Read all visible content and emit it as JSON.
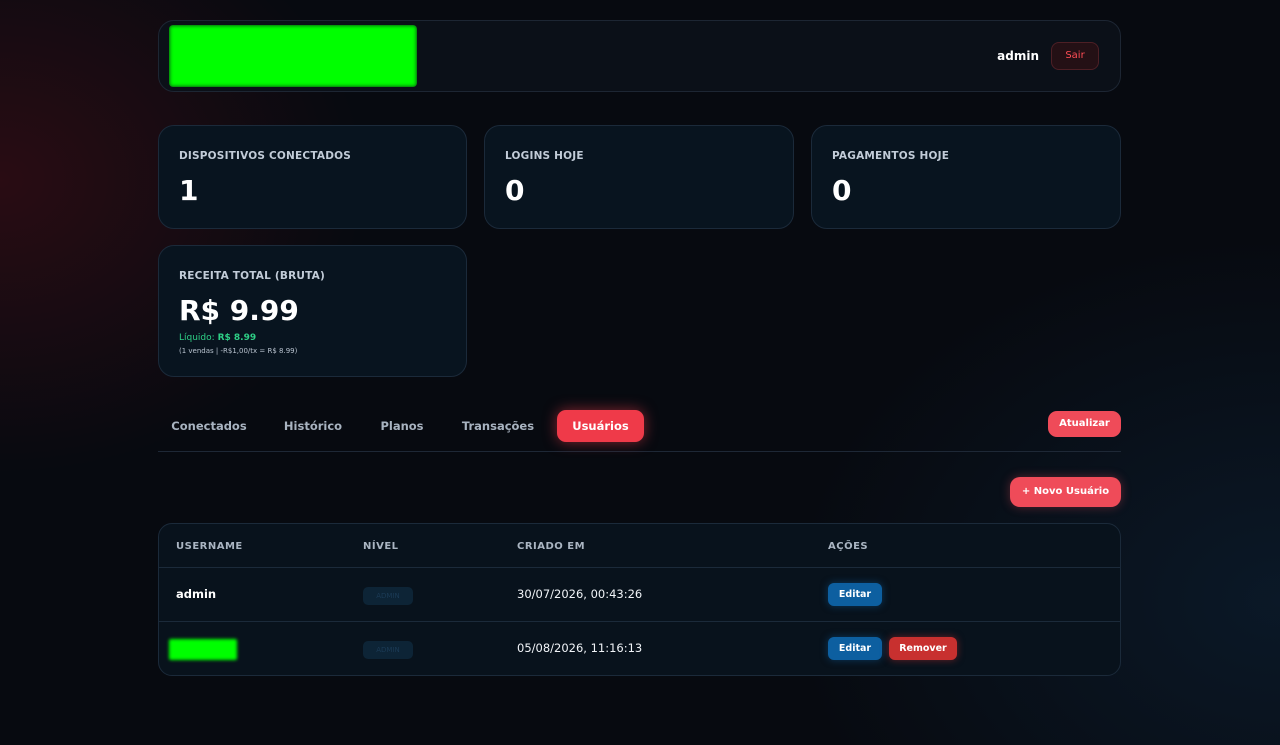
{
  "header": {
    "user": "admin",
    "logout_label": "Sair"
  },
  "stats": [
    {
      "label": "DISPOSITIVOS CONECTADOS",
      "value": "1"
    },
    {
      "label": "LOGINS HOJE",
      "value": "0"
    },
    {
      "label": "PAGAMENTOS HOJE",
      "value": "0"
    }
  ],
  "revenue": {
    "label": "RECEITA TOTAL (BRUTA)",
    "value": "R$ 9.99",
    "net_label": "Líquido:",
    "net_value": "R$ 8.99",
    "detail": "(1 vendas | -R$1,00/tx = R$ 8.99)"
  },
  "tabs": [
    {
      "label": "Conectados",
      "active": false
    },
    {
      "label": "Histórico",
      "active": false
    },
    {
      "label": "Planos",
      "active": false
    },
    {
      "label": "Transações",
      "active": false
    },
    {
      "label": "Usuários",
      "active": true
    }
  ],
  "refresh_label": "Atualizar",
  "new_user_label": "+ Novo Usuário",
  "table": {
    "columns": [
      "USERNAME",
      "NÍVEL",
      "CRIADO EM",
      "AÇÕES"
    ],
    "rows": [
      {
        "username": "admin",
        "level": "ADMIN",
        "created": "30/07/2026, 00:43:26",
        "actions": [
          "Editar"
        ]
      },
      {
        "username": "",
        "level": "ADMIN",
        "created": "05/08/2026, 11:16:13",
        "actions": [
          "Editar",
          "Remover"
        ]
      }
    ]
  },
  "colors": {
    "accent": "#ef3a49",
    "edit": "#0d5fa0",
    "remove": "#c8302f",
    "success": "#2ecf86"
  }
}
